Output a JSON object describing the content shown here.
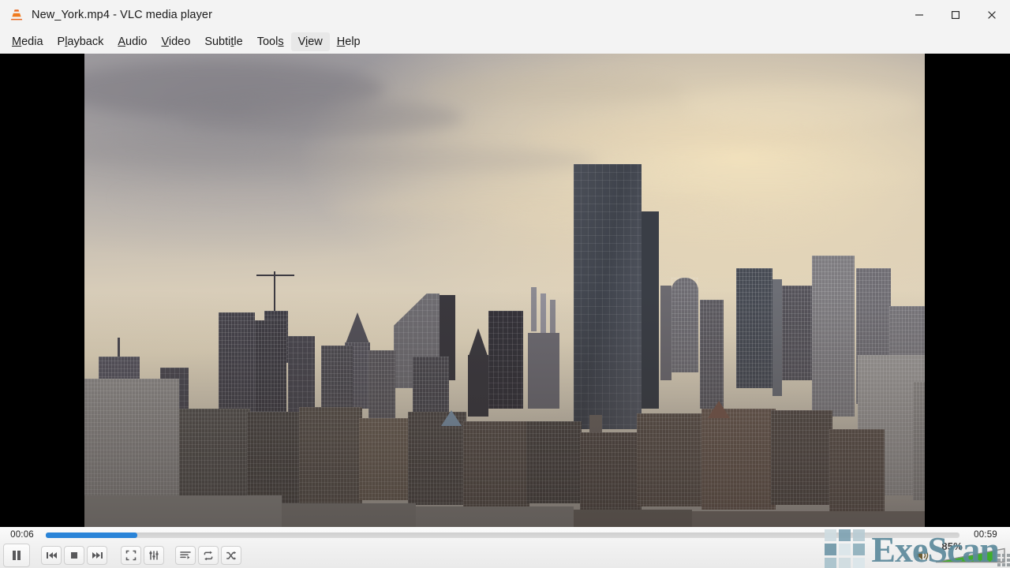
{
  "window": {
    "title": "New_York.mp4 - VLC media player",
    "app_icon": "vlc-cone-icon",
    "controls": [
      {
        "name": "minimize",
        "glyph": "minimize-icon"
      },
      {
        "name": "maximize",
        "glyph": "maximize-icon"
      },
      {
        "name": "close",
        "glyph": "close-icon"
      }
    ]
  },
  "menubar": {
    "items": [
      {
        "label": "Media",
        "pre": "",
        "key": "M",
        "post": "edia",
        "hovered": false
      },
      {
        "label": "Playback",
        "pre": "P",
        "key": "l",
        "post": "ayback",
        "hovered": false
      },
      {
        "label": "Audio",
        "pre": "",
        "key": "A",
        "post": "udio",
        "hovered": false
      },
      {
        "label": "Video",
        "pre": "",
        "key": "V",
        "post": "ideo",
        "hovered": false
      },
      {
        "label": "Subtitle",
        "pre": "Subti",
        "key": "t",
        "post": "le",
        "hovered": false
      },
      {
        "label": "Tools",
        "pre": "Tool",
        "key": "s",
        "post": "",
        "hovered": false
      },
      {
        "label": "View",
        "pre": "V",
        "key": "i",
        "post": "ew",
        "hovered": true
      },
      {
        "label": "Help",
        "pre": "",
        "key": "H",
        "post": "elp",
        "hovered": false
      }
    ]
  },
  "video": {
    "scene": "new-york-city-skyline-at-dusk",
    "letterbox_color": "#000000"
  },
  "transport": {
    "elapsed": "00:06",
    "duration": "00:59",
    "progress_percent": 10,
    "seek_fill_color": "#2a84d8",
    "buttons": [
      {
        "name": "play-pause-button",
        "icon": "pause-icon"
      },
      {
        "name": "previous-button",
        "icon": "previous-icon"
      },
      {
        "name": "stop-button",
        "icon": "stop-icon"
      },
      {
        "name": "next-button",
        "icon": "next-icon"
      },
      {
        "name": "fullscreen-button",
        "icon": "fullscreen-icon"
      },
      {
        "name": "extended-settings-button",
        "icon": "equalizer-icon"
      },
      {
        "name": "playlist-button",
        "icon": "playlist-icon"
      },
      {
        "name": "loop-button",
        "icon": "loop-icon"
      },
      {
        "name": "shuffle-button",
        "icon": "shuffle-icon"
      }
    ]
  },
  "volume": {
    "label": "85%",
    "percent": 85,
    "icon": "speaker-icon",
    "fill_color": "#3fae2a"
  },
  "watermark": {
    "text": "ExeScan",
    "color": "#5d8a9c",
    "grid_icon": "squares-grid-icon"
  }
}
